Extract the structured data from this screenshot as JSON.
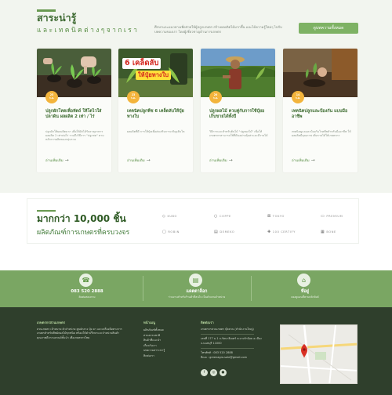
{
  "knowledge": {
    "title": "สาระน่ารู้",
    "subtitle": "และเทคนิคต่างๆจากเรา",
    "intro": "ศึกษาและแนวทางเพื่อช่วยให้ผู้ปลูกเกษตร สร้างผลผลิตได้มากขึ้น และได้ความรู้ใหม่ๆ ไปกับบทความของเรา โดยผู้เชี่ยวชาญด้านการเกษตร",
    "all_button": "ดูบทความทั้งหมด",
    "cards": [
      {
        "date_day": "25",
        "date_month": "ก.ค.",
        "title": "ปลูกผักโหดเพื่อหัตถ์ ให้โตไวใส่ปลาดิน ผลผลิต 2 เท่า / ไร่",
        "excerpt": "ปลูกผักให้ผลผลิตมาก เพื่อให้ผักได้รับธาตุอาหาร ผลผลิต 2 เท่าต่อไร่ รวมถึงวิธีการ \"ปลูกสด\" ตามหลักการผลิตของกลุ่มรวม",
        "more": "อ่านเพิ่มเติม"
      },
      {
        "date_day": "23",
        "date_month": "ก.ค.",
        "title": "เทคนิคปลูกพืช 6 เคล็ดลับให้ปุ๋ยทางใบ",
        "excerpt": "ผลผลิตที่ดี การให้ปุ๋ยเพื่อส่งเสริมการเจริญเติบโต",
        "more": "อ่านเพิ่มเติม",
        "photo_text_1": "6 เคล็ดลับ",
        "photo_text_2": "ให้ปุ๋ยทางใบ"
      },
      {
        "date_day": "20",
        "date_month": "ก.ค.",
        "title": "ปลูกผลไม้ ควบคู่กับการใช้ปุ๋ยอ เก็บขายได้ทั้งปี",
        "excerpt": "วิธีการและสำหรับต้นไม้ \"ปลูกผลไม้\" เพื่อให้เกษตรกรสามารถใช้ที่ดินอย่างคุ้มค่าและมีรายได้",
        "more": "อ่านเพิ่มเติม"
      },
      {
        "date_day": "14",
        "date_month": "ก.ค.",
        "title": "เทคนิคปลูกและป้องกัน แบบมืออาชีพ",
        "excerpt": "เทคนิคดูแลและป้องกันโรคพืชสำหรับมืออาชีพ ให้ผลผลิตมีคุณภาพ เพิ่มรายได้ให้เกษตรกร",
        "more": "อ่านเพิ่มเติม"
      }
    ]
  },
  "stats": {
    "headline": "มากกว่า 10,000 ชิ้น",
    "subline": "ผลิตภัณฑ์การเกษตรที่ครบวงจร",
    "brands": [
      "KUBO",
      "COPPE",
      "TOKYO",
      "PREMIUM",
      "ROBIN",
      "DEMEKO",
      "100 CERTIFY",
      "BONE"
    ]
  },
  "contact": [
    {
      "icon": "phone-icon",
      "main": "083 520 2888",
      "sub": "ติดต่อสอบถาม"
    },
    {
      "icon": "catalog-icon",
      "main": "แคตตาล็อก",
      "sub": "ร่วมงานสำหรับร้านค้าที่สนใจ เป็นตัวแทนจำหน่าย"
    },
    {
      "icon": "location-icon",
      "main": "ที่อยู่",
      "sub": "ลองดูแผนที่ตามคลิกลิงค์"
    }
  ],
  "footer": {
    "about_title": "เกษตรกรสวนเกษตร",
    "about_text": "สวนเกษตร เป้าหมาย ตัวจำหน่าย ศูนย์กลาง ปุ๋ย ยา และเครื่องมือทางการเกษตรสำหรับพืชผักผลไม้ทุกชนิด พร้อมให้คำปรึกษาและจำหน่ายสินค้าคุณภาพดีจากแบรนด์ชั้นนำ เพื่อเกษตรกรไทย",
    "menu_title": "หน้าเมนู",
    "menu": [
      "ผลิตภัณฑ์ทั้งหมด",
      "สวนธรรมชาติ",
      "สินค้าที่แนะนำ",
      "เกี่ยวกับเรา",
      "บทความสาระน่ารู้",
      "ติดต่อเรา"
    ],
    "contact_title": "ติดต่อเรา",
    "company": "เกษตรกรสวนเกษตร บุ๊คสวน (สำนักงานใหญ่)",
    "address": "เลขที่ 177 ม.1 ถ.รัตนาธิเบศร์ ต.บางรักน้อย อ.เมือง จ.นนทบุรี 11000",
    "phone": "โทรศัพท์ : 083 520 2888",
    "email": "อีเมล : greenagro.sale@gmail.com"
  }
}
